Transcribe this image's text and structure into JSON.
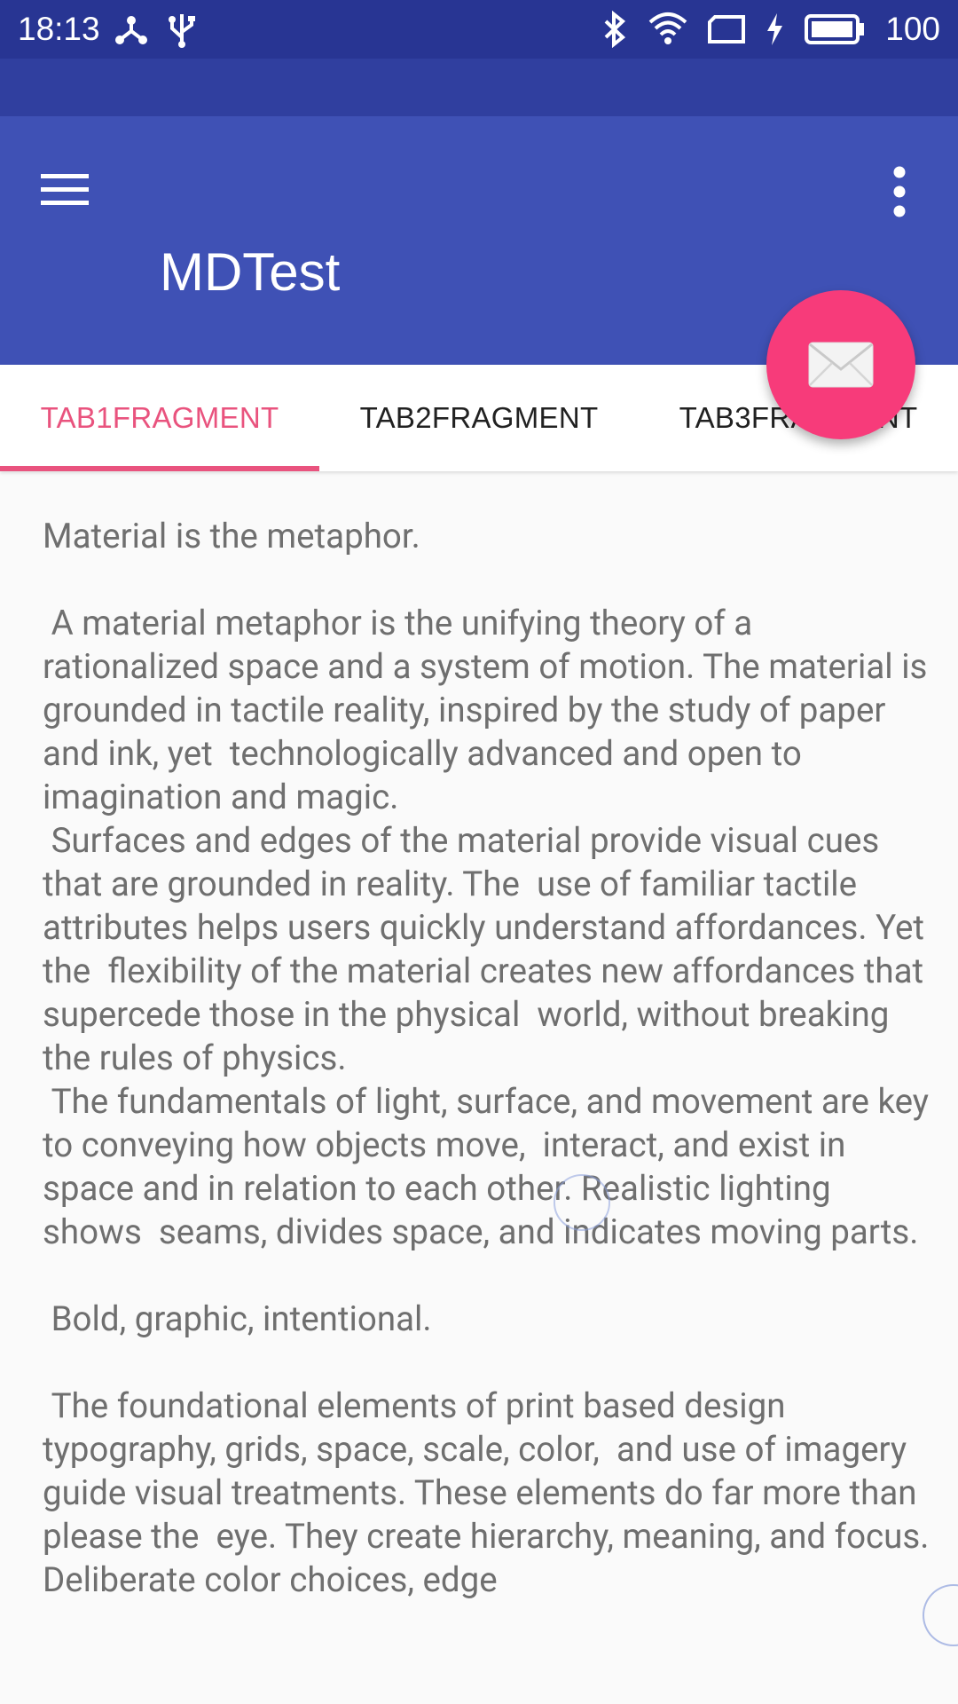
{
  "status_bar": {
    "time": "18:13",
    "battery_level": "100",
    "icons": [
      "share-icon",
      "usb-icon",
      "bluetooth-icon",
      "wifi-icon",
      "screen-icon",
      "charging-icon",
      "battery-icon"
    ]
  },
  "app_bar": {
    "title": "MDTest",
    "background_color": "#3f51b5",
    "menu_icon": "hamburger-menu-icon",
    "overflow_icon": "more-vert-icon"
  },
  "tabs": [
    {
      "label": "TAB1FRAGMENT",
      "selected": true
    },
    {
      "label": "TAB2FRAGMENT",
      "selected": false
    },
    {
      "label": "TAB3FRAGMENT",
      "selected": false
    }
  ],
  "accent_color": "#e9537e",
  "fab": {
    "icon": "mail-icon",
    "color": "#f73b7a"
  },
  "content": {
    "text": "Material is the metaphor.\n\n A material metaphor is the unifying theory of a rationalized space and a system of motion. The material is grounded in tactile reality, inspired by the study of paper and ink, yet  technologically advanced and open to imagination and magic.\n Surfaces and edges of the material provide visual cues that are grounded in reality. The  use of familiar tactile attributes helps users quickly understand affordances. Yet the  flexibility of the material creates new affordances that supercede those in the physical  world, without breaking the rules of physics.\n The fundamentals of light, surface, and movement are key to conveying how objects move,  interact, and exist in space and in relation to each other. Realistic lighting shows  seams, divides space, and indicates moving parts.\n\n Bold, graphic, intentional.\n\n The foundational elements of print based design typography, grids, space, scale, color,  and use of imagery guide visual treatments. These elements do far more than please the  eye. They create hierarchy, meaning, and focus. Deliberate color choices, edge"
  }
}
